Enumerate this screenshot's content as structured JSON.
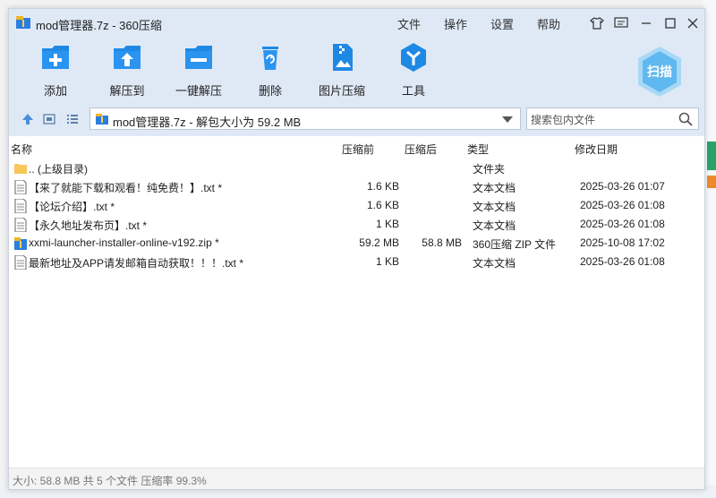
{
  "window": {
    "title": "mod管理器.7z - 360压缩",
    "menu": [
      "文件",
      "操作",
      "设置",
      "帮助"
    ]
  },
  "toolbar": {
    "items": [
      {
        "label": "添加",
        "icon": "add-icon"
      },
      {
        "label": "解压到",
        "icon": "extract-to-icon"
      },
      {
        "label": "一键解压",
        "icon": "one-click-extract-icon"
      },
      {
        "label": "删除",
        "icon": "delete-icon"
      },
      {
        "label": "图片压缩",
        "icon": "image-compress-icon"
      },
      {
        "label": "工具",
        "icon": "tools-icon"
      }
    ],
    "scan_label": "扫描"
  },
  "address": {
    "path": "mod管理器.7z - 解包大小为 59.2 MB",
    "search_placeholder": "搜索包内文件"
  },
  "columns": {
    "name": "名称",
    "compressed_before": "压缩前",
    "compressed_after": "压缩后",
    "type": "类型",
    "modified": "修改日期"
  },
  "files": [
    {
      "name": ".. (上级目录)",
      "size": "",
      "packed": "",
      "type": "文件夹",
      "date": "",
      "icon": "folder-icon"
    },
    {
      "name": "【来了就能下载和观看！纯免费！】.txt *",
      "size": "1.6 KB",
      "packed": "",
      "type": "文本文档",
      "date": "2025-03-26 01:07",
      "icon": "text-file-icon"
    },
    {
      "name": "【论坛介绍】.txt *",
      "size": "1.6 KB",
      "packed": "",
      "type": "文本文档",
      "date": "2025-03-26 01:08",
      "icon": "text-file-icon"
    },
    {
      "name": "【永久地址发布页】.txt *",
      "size": "1 KB",
      "packed": "",
      "type": "文本文档",
      "date": "2025-03-26 01:08",
      "icon": "text-file-icon"
    },
    {
      "name": "xxmi-launcher-installer-online-v192.zip *",
      "size": "59.2 MB",
      "packed": "58.8 MB",
      "type": "360压缩 ZIP 文件",
      "date": "2025-10-08 17:02",
      "icon": "zip-file-icon"
    },
    {
      "name": "最新地址及APP请发邮箱自动获取！！！.txt *",
      "size": "1 KB",
      "packed": "",
      "type": "文本文档",
      "date": "2025-03-26 01:08",
      "icon": "text-file-icon"
    }
  ],
  "status": "大小: 58.8 MB 共 5 个文件 压缩率 99.3%",
  "colors": {
    "accent": "#1e88e5",
    "titlebar": "#dfe9f6"
  }
}
